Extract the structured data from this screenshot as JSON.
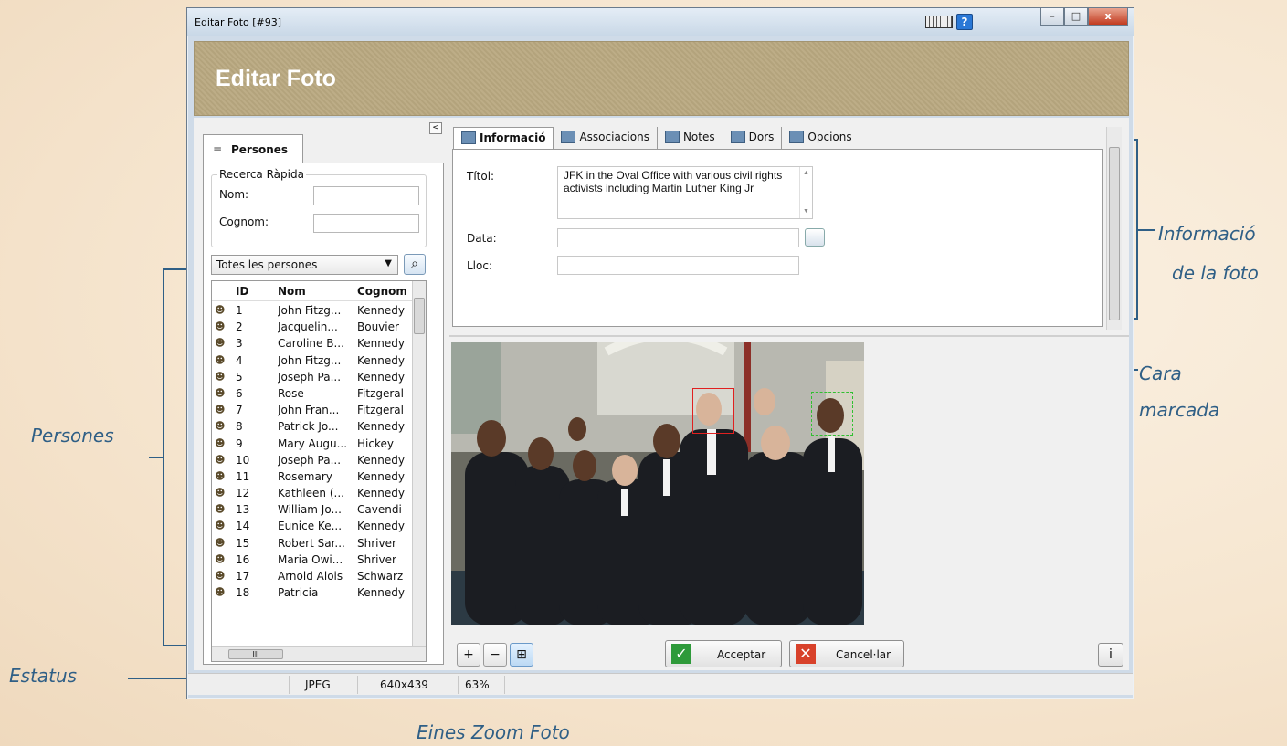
{
  "window": {
    "title": "Editar Foto [#93]",
    "banner_title": "Editar Foto",
    "minimize": "–",
    "maximize": "□",
    "close": "x"
  },
  "people_panel": {
    "tab_label": "Persones",
    "collapse": "<",
    "quick_search": {
      "title": "Recerca Ràpida",
      "nom_label": "Nom:",
      "nom_value": "",
      "cognom_label": "Cognom:",
      "cognom_value": ""
    },
    "filter": "Totes les persones",
    "columns": [
      "ID",
      "Nom",
      "Cognom"
    ],
    "rows": [
      {
        "id": "1",
        "nom": "John Fitzg...",
        "cognom": "Kennedy"
      },
      {
        "id": "2",
        "nom": "Jacquelin...",
        "cognom": "Bouvier"
      },
      {
        "id": "3",
        "nom": "Caroline B...",
        "cognom": "Kennedy"
      },
      {
        "id": "4",
        "nom": "John Fitzg...",
        "cognom": "Kennedy"
      },
      {
        "id": "5",
        "nom": "Joseph Pa...",
        "cognom": "Kennedy"
      },
      {
        "id": "6",
        "nom": "Rose",
        "cognom": "Fitzgeral"
      },
      {
        "id": "7",
        "nom": "John Fran...",
        "cognom": "Fitzgeral"
      },
      {
        "id": "8",
        "nom": "Patrick Jo...",
        "cognom": "Kennedy"
      },
      {
        "id": "9",
        "nom": "Mary Augu...",
        "cognom": "Hickey"
      },
      {
        "id": "10",
        "nom": "Joseph Pa...",
        "cognom": "Kennedy"
      },
      {
        "id": "11",
        "nom": "Rosemary",
        "cognom": "Kennedy"
      },
      {
        "id": "12",
        "nom": "Kathleen (...",
        "cognom": "Kennedy"
      },
      {
        "id": "13",
        "nom": "William Jo...",
        "cognom": "Cavendi"
      },
      {
        "id": "14",
        "nom": "Eunice Ke...",
        "cognom": "Kennedy"
      },
      {
        "id": "15",
        "nom": "Robert Sar...",
        "cognom": "Shriver"
      },
      {
        "id": "16",
        "nom": "Maria Owi...",
        "cognom": "Shriver"
      },
      {
        "id": "17",
        "nom": "Arnold Alois",
        "cognom": "Schwarz"
      },
      {
        "id": "18",
        "nom": "Patricia",
        "cognom": "Kennedy"
      }
    ]
  },
  "tabs": [
    "Informació",
    "Associacions",
    "Notes",
    "Dors",
    "Opcions"
  ],
  "info": {
    "titol_label": "Títol:",
    "titol_value": "JFK in the Oval Office with various civil rights activists including Martin Luther King Jr",
    "data_label": "Data:",
    "data_value": "",
    "lloc_label": "Lloc:",
    "lloc_value": ""
  },
  "buttons": {
    "accept": "Acceptar",
    "cancel": "Cancel·lar",
    "zoom_in": "+",
    "zoom_out": "−",
    "zoom_fit": "⊞",
    "info": "i"
  },
  "status": {
    "format": "JPEG",
    "dimensions": "640x439",
    "zoom": "63%"
  },
  "annotations": {
    "persones": "Persones",
    "estatus": "Estatus",
    "info_line1": "Informació",
    "info_line2": "de la foto",
    "cara_line1": "Cara",
    "cara_line2": "marcada",
    "zoom_tools": "Eines Zoom Foto"
  },
  "colors": {
    "annotation": "#2f5f86",
    "banner": "#b9a880",
    "accept_icon": "#2e9a3a",
    "cancel_icon": "#d8412a",
    "face_marked": "#e02020",
    "face_suggested": "#30c030"
  }
}
